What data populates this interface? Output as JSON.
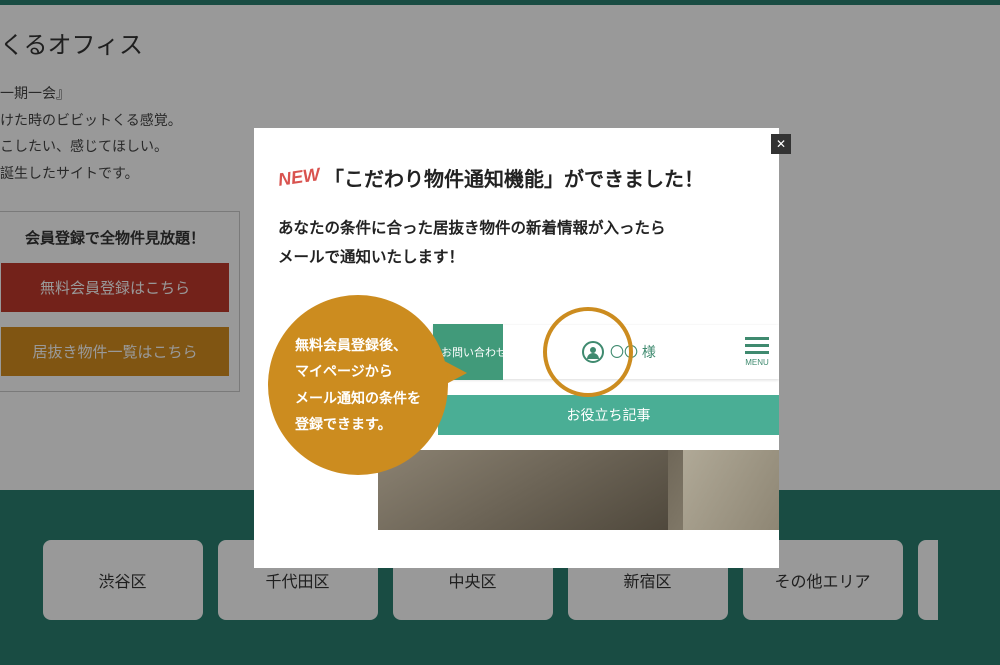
{
  "hero": {
    "title_suffix": "くるオフィス",
    "line1": "一期一会』",
    "line2": "けた時のビビットくる感覚。",
    "line3": "こしたい、感じてほしい。",
    "line4": "誕生したサイトです。"
  },
  "signup": {
    "heading": "会員登録で全物件見放題！",
    "register_btn": "無料会員登録はこちら",
    "list_btn": "居抜き物件一覧はこちら"
  },
  "areas": [
    "渋谷区",
    "千代田区",
    "中央区",
    "新宿区",
    "その他エリア"
  ],
  "modal": {
    "new_label": "NEW",
    "title_rest": "「こだわり物件通知機能」ができました！",
    "lead_l1": "あなたの条件に合った居抜き物件の新着情報が入ったら",
    "lead_l2": "メールで通知いたします！",
    "bubble_l1": "無料会員登録後、",
    "bubble_l2": "マイページから",
    "bubble_l3": "メール通知の条件を",
    "bubble_l4": "登録できます。",
    "demo_inquiry": "お問い合わせ",
    "demo_user": "〇〇 様",
    "demo_menu": "MENU",
    "demo_subnav": "お役立ち記事",
    "close": "✕"
  }
}
